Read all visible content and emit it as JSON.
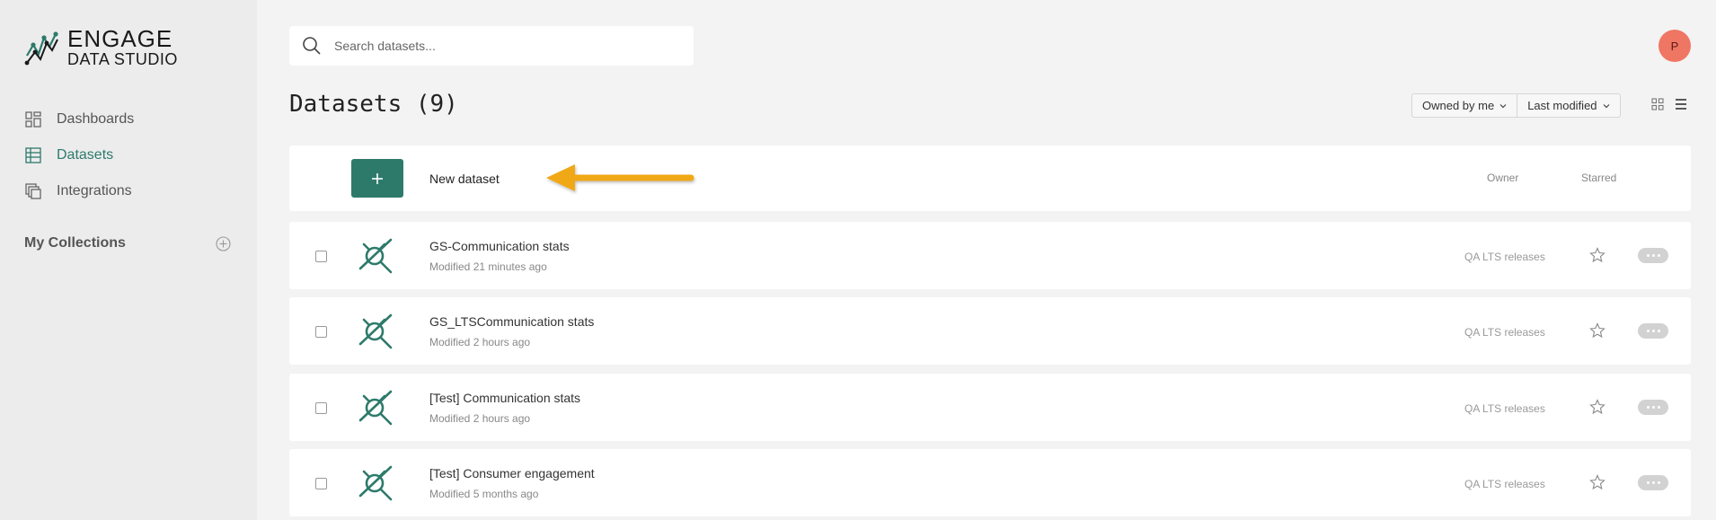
{
  "brand": {
    "line1": "ENGAGE",
    "line2": "DATA STUDIO",
    "accent": "#2d7a6b"
  },
  "nav": {
    "items": [
      {
        "label": "Dashboards",
        "icon": "dashboard-icon"
      },
      {
        "label": "Datasets",
        "icon": "table-icon",
        "active": true
      },
      {
        "label": "Integrations",
        "icon": "integrations-icon"
      }
    ],
    "collections_label": "My Collections"
  },
  "search": {
    "placeholder": "Search datasets..."
  },
  "user": {
    "initial": "P",
    "color": "#f07664"
  },
  "page": {
    "title": "Datasets (9)"
  },
  "filters": {
    "owner": "Owned by me",
    "sort": "Last modified"
  },
  "list": {
    "new_label": "New dataset",
    "owner_header": "Owner",
    "starred_header": "Starred",
    "rows": [
      {
        "name": "GS-Communication stats",
        "modified": "Modified 21 minutes ago",
        "owner": "QA LTS releases"
      },
      {
        "name": "GS_LTSCommunication stats",
        "modified": "Modified 2 hours ago",
        "owner": "QA LTS releases"
      },
      {
        "name": "[Test] Communication stats",
        "modified": "Modified 2 hours ago",
        "owner": "QA LTS releases"
      },
      {
        "name": "[Test] Consumer engagement",
        "modified": "Modified 5 months ago",
        "owner": "QA LTS releases"
      }
    ]
  }
}
